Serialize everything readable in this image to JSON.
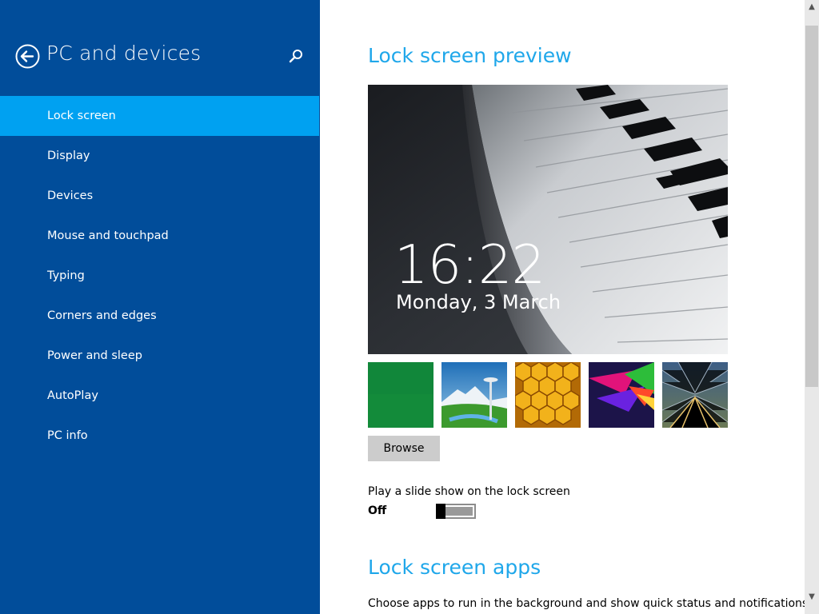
{
  "sidebar": {
    "title": "PC and devices",
    "back_icon": "back-arrow-icon",
    "search_icon": "search-icon",
    "background": "#014d9a",
    "selected_color": "#00a1f1",
    "items": [
      {
        "label": "Lock screen",
        "selected": true
      },
      {
        "label": "Display"
      },
      {
        "label": "Devices"
      },
      {
        "label": "Mouse and touchpad"
      },
      {
        "label": "Typing"
      },
      {
        "label": "Corners and edges"
      },
      {
        "label": "Power and sleep"
      },
      {
        "label": "AutoPlay"
      },
      {
        "label": "PC info"
      }
    ]
  },
  "main": {
    "accent": "#1fa7ea",
    "preview_title": "Lock screen preview",
    "preview": {
      "time": "16:22",
      "date": "Monday, 3 March"
    },
    "thumbnails": [
      {
        "name": "green-background-thumbnail"
      },
      {
        "name": "space-needle-thumbnail"
      },
      {
        "name": "honeycomb-thumbnail"
      },
      {
        "name": "colorful-shapes-thumbnail"
      },
      {
        "name": "train-tracks-thumbnail"
      }
    ],
    "browse_label": "Browse",
    "slideshow": {
      "label": "Play a slide show on the lock screen",
      "state": "Off"
    },
    "apps_title": "Lock screen apps",
    "apps_description": "Choose apps to run in the background and show quick status and notifications,"
  },
  "scrollbar": {
    "up_icon": "scroll-up-arrow-icon",
    "down_icon": "scroll-down-arrow-icon"
  }
}
